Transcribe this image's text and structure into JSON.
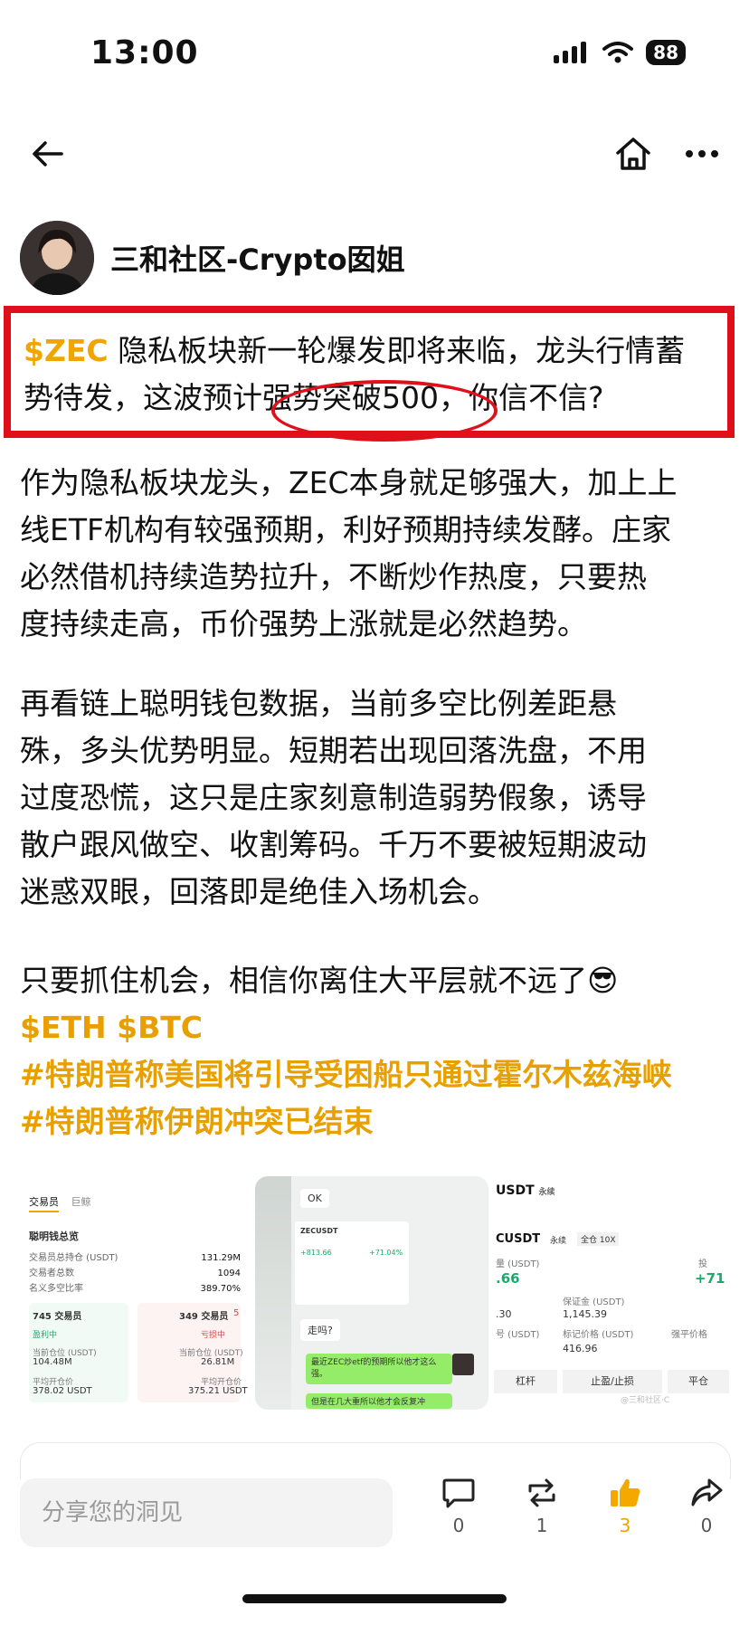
{
  "status_bar": {
    "time": "13:00",
    "battery": "88"
  },
  "author": {
    "name": "三和社区-Crypto囡姐"
  },
  "post": {
    "headline_tag": "$ZEC",
    "headline_line1": " 隐私板块新一轮爆发即将来临，龙头行情蓄",
    "headline_line2": "势待发，这波预计强势突破500，你信不信?",
    "para1_lines": [
      "作为隐私板块龙头，ZEC本身就足够强大，加上上",
      "线ETF机构有较强预期，利好预期持续发酵。庄家",
      "必然借机持续造势拉升，不断炒作热度，只要热",
      "度持续走高，币价强势上涨就是必然趋势。"
    ],
    "para2_lines": [
      "再看链上聪明钱包数据，当前多空比例差距悬",
      "殊，多头优势明显。短期若出现回落洗盘，不用",
      "过度恐慌，这只是庄家刻意制造弱势假象，诱导",
      "散户跟风做空、收割筹码。千万不要被短期波动",
      "迷惑双眼，回落即是绝佳入场机会。"
    ],
    "para3": "只要抓住机会，相信你离住大平层就不远了😎",
    "cashtags": "$ETH $BTC",
    "hashtag1": "#特朗普称美国将引导受困船只通过霍尔木兹海峡",
    "hashtag2": "#特朗普称伊朗冲突已结束"
  },
  "image1": {
    "tab_active": "交易员",
    "tab_other": "巨鲸",
    "section": "聪明钱总览",
    "rows": [
      {
        "label": "交易员总持仓 (USDT)",
        "value": "131.29M"
      },
      {
        "label": "交易者总数",
        "value": "1094"
      },
      {
        "label": "名义多空比率",
        "value": "389.70%"
      }
    ],
    "long_count": "745 交易员",
    "short_count": "349 交易员",
    "short_badge": "5",
    "long_tag": "盈利中",
    "short_tag": "亏损中",
    "long_pos_label": "当前仓位 (USDT)",
    "long_pos": "104.48M",
    "short_pos_label": "当前仓位 (USDT)",
    "short_pos": "26.81M",
    "long_avg_label": "平均开仓价",
    "long_avg": "378.02 USDT",
    "short_avg_label": "平均开仓价",
    "short_avg": "375.21 USDT"
  },
  "image2": {
    "ok": "OK",
    "pair": "ZECUSDT",
    "pnl1": "+813.66",
    "pnl2": "+71.04%",
    "q1": "走吗?",
    "msg": "最近ZEC炒etf的预期所以他才这么强。",
    "msg2": "但是在几大重所以他才会反复冲"
  },
  "image3": {
    "pair": "USDT",
    "perp": "永续",
    "pair_full": "CUSDT",
    "perp2": "永续",
    "mode": "全仓 10X",
    "size_label": "量 (USDT)",
    "pnl": ".66",
    "pnl_right": "+71",
    "invest": "投",
    "margin_label": "保证金 (USDT)",
    "margin": "1,145.39",
    "entry_partial": ".30",
    "entry_label": "号 (USDT)",
    "mark_label": "标记价格 (USDT)",
    "mark": "416.96",
    "liq_label": "强平价格",
    "btn1": "杠杆",
    "btn2": "止盈/止损",
    "btn3": "平仓",
    "watermark": "@三和社区·C"
  },
  "share": {
    "placeholder": "分享您的洞见"
  },
  "actions": {
    "comments": "0",
    "reposts": "1",
    "likes": "3",
    "shares": "0"
  },
  "colors": {
    "accent": "#f0a500",
    "highlight_border": "#e0101a",
    "green": "#1aab6b",
    "red": "#e04646"
  }
}
